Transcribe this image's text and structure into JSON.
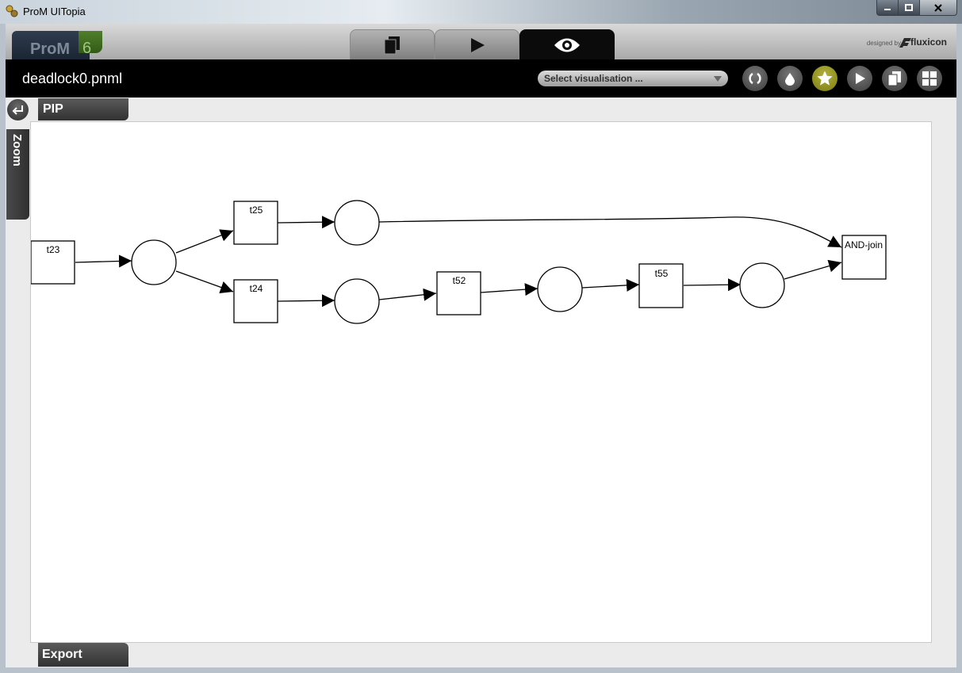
{
  "window": {
    "title": "ProM UITopia"
  },
  "header": {
    "logo_text": "ProM",
    "logo_version": "6",
    "designed_by": "designed by",
    "brand": "fluxicon",
    "tabs": [
      {
        "name": "workspace",
        "icon": "documents-icon"
      },
      {
        "name": "actions",
        "icon": "play-icon"
      },
      {
        "name": "views",
        "icon": "eye-icon",
        "active": true
      }
    ]
  },
  "toolbar": {
    "document_title": "deadlock0.pnml",
    "visualisation_select": {
      "value": "Select visualisation ..."
    },
    "buttons": [
      {
        "name": "refresh-button",
        "icon": "refresh-icon"
      },
      {
        "name": "drop-button",
        "icon": "drop-icon"
      },
      {
        "name": "favorite-button",
        "icon": "star-icon",
        "active": true
      },
      {
        "name": "play-button",
        "icon": "play-icon"
      },
      {
        "name": "copy-button",
        "icon": "copy-icon"
      },
      {
        "name": "grid-button",
        "icon": "grid-icon"
      }
    ]
  },
  "panels": {
    "pip": "PIP",
    "zoom": "Zoom",
    "export": "Export"
  },
  "petri_net": {
    "transitions": [
      {
        "id": "t23",
        "label": "t23"
      },
      {
        "id": "t25",
        "label": "t25"
      },
      {
        "id": "t24",
        "label": "t24"
      },
      {
        "id": "t52",
        "label": "t52"
      },
      {
        "id": "t55",
        "label": "t55"
      },
      {
        "id": "and",
        "label": "AND-join"
      }
    ],
    "places": [
      {
        "id": "p1"
      },
      {
        "id": "p2"
      },
      {
        "id": "p3"
      },
      {
        "id": "p4"
      },
      {
        "id": "p5"
      }
    ],
    "arcs": [
      {
        "from": "t23",
        "to": "p1"
      },
      {
        "from": "p1",
        "to": "t25"
      },
      {
        "from": "p1",
        "to": "t24"
      },
      {
        "from": "t25",
        "to": "p2"
      },
      {
        "from": "p2",
        "to": "and"
      },
      {
        "from": "t24",
        "to": "p3"
      },
      {
        "from": "p3",
        "to": "t52"
      },
      {
        "from": "t52",
        "to": "p4"
      },
      {
        "from": "p4",
        "to": "t55"
      },
      {
        "from": "t55",
        "to": "p5"
      },
      {
        "from": "p5",
        "to": "and"
      }
    ]
  },
  "colors": {
    "accent_active": "#9a9a22",
    "toolbar_bg": "#000000",
    "canvas_bg": "#ffffff"
  }
}
